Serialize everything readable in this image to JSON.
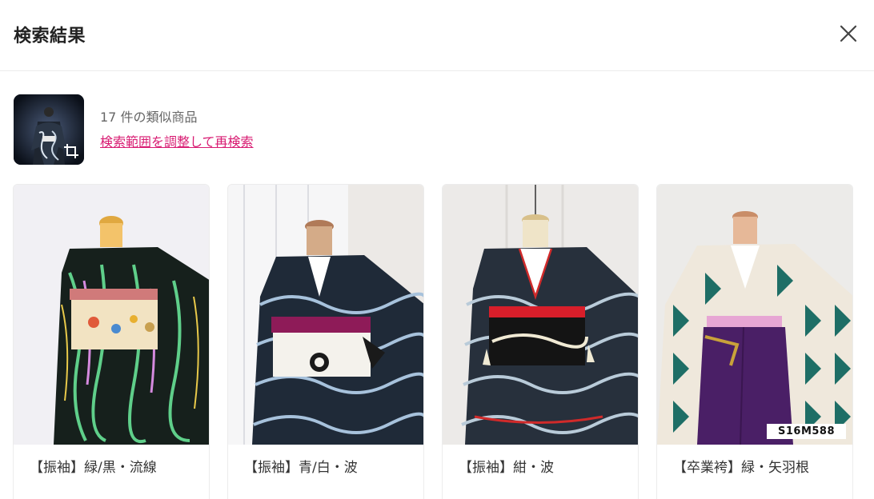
{
  "header": {
    "title": "検索結果",
    "close_icon": "close-icon"
  },
  "query": {
    "thumbnail": "query-kimono-thumbnail",
    "crop_icon": "crop-icon",
    "count_text": "17 件の類似商品",
    "refine_link": "検索範囲を調整して再検索"
  },
  "results": [
    {
      "name": "【振袖】緑/黒・流線"
    },
    {
      "name": "【振袖】青/白・波"
    },
    {
      "name": "【振袖】紺・波"
    },
    {
      "name": "【卒業袴】緑・矢羽根",
      "badge": "S16M588"
    }
  ],
  "colors": {
    "link": "#d81b72",
    "border": "#ececec"
  }
}
